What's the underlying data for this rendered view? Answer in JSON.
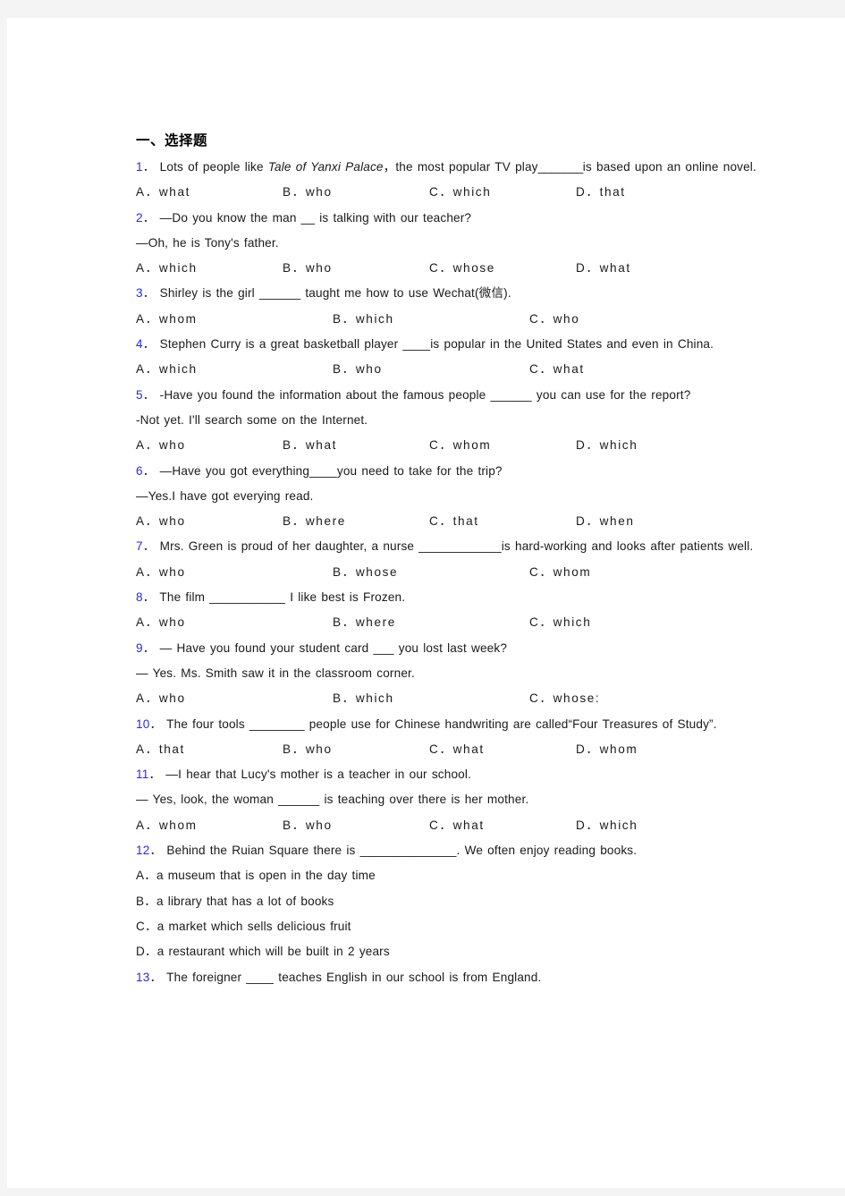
{
  "document": {
    "section_heading": "一、选择题"
  },
  "questions": [
    {
      "num": "1",
      "dot": "．",
      "stem_parts": [
        {
          "t": "Lots of people like ",
          "style": "normal"
        },
        {
          "t": "Tale of Yanxi Palace",
          "style": "italic"
        },
        {
          "t": "，the most popular TV play",
          "style": "normal"
        },
        {
          "t": "_______",
          "style": "blank"
        },
        {
          "t": "is based upon an online novel.",
          "style": "normal"
        }
      ],
      "stem_plain": "Lots of people like Tale of Yanxi Palace，the most popular TV play_______is based upon an online novel.",
      "options": [
        "A．what",
        "B．who",
        "C．which",
        "D．that"
      ],
      "option_count": 4
    },
    {
      "num": "2",
      "dot": "．",
      "stem_plain": "—Do you know the man  __  is talking with our teacher?",
      "stem_line2": "—Oh, he is Tony's father.",
      "options": [
        "A．which",
        "B．who",
        "C．whose",
        "D．what"
      ],
      "option_count": 4
    },
    {
      "num": "3",
      "dot": "．",
      "stem_plain": "Shirley is the girl ______ taught me how to use Wechat(微信).",
      "options": [
        "A．whom",
        "B．which",
        "C．who"
      ],
      "option_count": 3
    },
    {
      "num": "4",
      "dot": "．",
      "stem_plain": "Stephen Curry is a great basketball player ____is popular in the United States and even in China.",
      "options": [
        "A．which",
        "B．who",
        "C．what"
      ],
      "option_count": 3
    },
    {
      "num": "5",
      "dot": "．",
      "stem_plain": "-Have you found the information about the famous people ______ you can use for the report?",
      "stem_line2": " -Not yet. I'll search some on the Internet.",
      "options": [
        "A．who",
        "B．what",
        "C．whom",
        "D．which"
      ],
      "option_count": 4
    },
    {
      "num": "6",
      "dot": "．",
      "stem_plain": "—Have you got everything____you need to take for the trip?",
      "stem_line2": " —Yes.I have got everying read.",
      "options": [
        "A．who",
        "B．where",
        "C．that",
        "D．when"
      ],
      "option_count": 4
    },
    {
      "num": "7",
      "dot": "．",
      "stem_plain": "Mrs. Green is proud of her daughter, a nurse ____________is hard-working and looks after patients well.",
      "options": [
        "A．who",
        "B．whose",
        "C．whom"
      ],
      "option_count": 3
    },
    {
      "num": "8",
      "dot": "．",
      "stem_plain": "The film ___________ I like best is Frozen.",
      "options": [
        "A．who",
        "B．where",
        "C．which"
      ],
      "option_count": 3
    },
    {
      "num": "9",
      "dot": "．",
      "stem_plain": "— Have you found your student card   ___  you lost last week?",
      "stem_line2": "— Yes. Ms. Smith saw it in the classroom corner.",
      "options": [
        "A．who",
        "B．which",
        "C．whose:"
      ],
      "option_count": 3
    },
    {
      "num": "10",
      "dot": "．",
      "stem_plain": "The four tools ________ people use for Chinese handwriting are called“Four Treasures of Study”.",
      "options": [
        "A．that",
        "B．who",
        "C．what",
        "D．whom"
      ],
      "option_count": 4
    },
    {
      "num": "11",
      "dot": "．",
      "stem_plain": "—I hear that Lucy's mother is a teacher in our school.",
      "stem_line2": "— Yes, look, the woman ______ is teaching over there is her mother.",
      "options": [
        "A．whom",
        "B．who",
        "C．what",
        "D．which"
      ],
      "option_count": 4
    },
    {
      "num": "12",
      "dot": "．",
      "stem_plain": "Behind the Ruian Square there is ______________. We often enjoy reading books.",
      "options": [
        "A．a museum that is open in the day time",
        "B．a library that has a lot of books",
        "C．a market which sells delicious fruit",
        "D．a restaurant which will be built in 2 years"
      ],
      "option_count": 4,
      "stacked": true
    },
    {
      "num": "13",
      "dot": "．",
      "stem_plain": "The foreigner ____   teaches English in our school is from England.",
      "options": [],
      "option_count": 0
    }
  ]
}
